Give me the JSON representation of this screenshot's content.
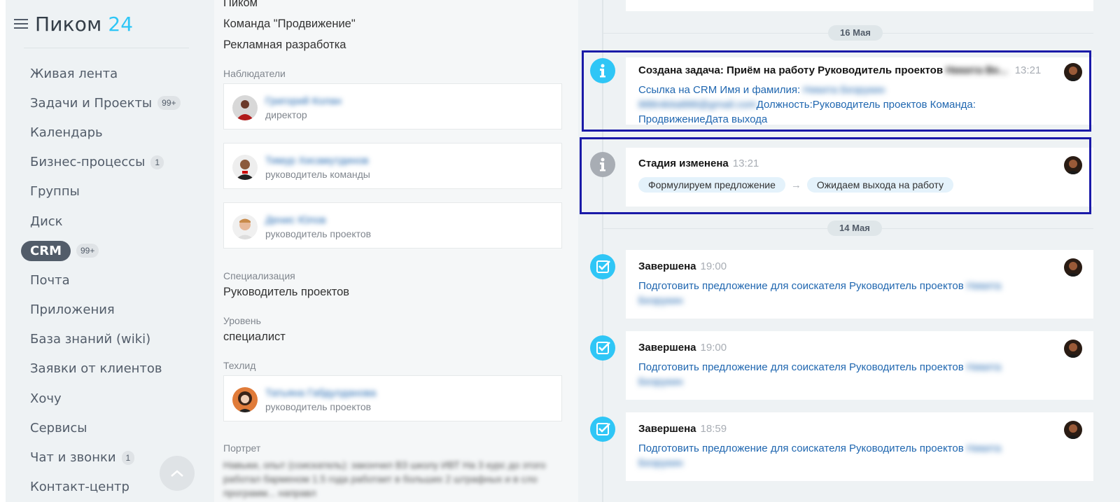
{
  "app": {
    "name": "Пиком",
    "number": "24"
  },
  "sidebar": {
    "items": [
      {
        "label": "Живая лента"
      },
      {
        "label": "Задачи и Проекты",
        "counter": "99+"
      },
      {
        "label": "Календарь"
      },
      {
        "label": "Бизнес-процессы",
        "counter": "1"
      },
      {
        "label": "Группы"
      },
      {
        "label": "Диск"
      },
      {
        "label": "CRM",
        "counter": "99+",
        "active": true
      },
      {
        "label": "Почта"
      },
      {
        "label": "Приложения"
      },
      {
        "label": "База знаний (wiki)"
      },
      {
        "label": "Заявки от клиентов"
      },
      {
        "label": "Хочу"
      },
      {
        "label": "Сервисы"
      },
      {
        "label": "Чат и звонки",
        "counter": "1"
      },
      {
        "label": "Контакт-центр"
      }
    ]
  },
  "details": {
    "company": "Пиком",
    "team": "Команда \"Продвижение\"",
    "department": "Рекламная разработка",
    "observers_label": "Наблюдатели",
    "observers": [
      {
        "name": "Григорий Колан",
        "role": "директор"
      },
      {
        "name": "Тимур Хисамутдинов",
        "role": "руководитель команды"
      },
      {
        "name": "Денис Юлов",
        "role": "руководитель проектов"
      }
    ],
    "specialization_label": "Специализация",
    "specialization": "Руководитель проектов",
    "level_label": "Уровень",
    "level": "специалист",
    "techlead_label": "Техлид",
    "techlead": {
      "name": "Татьяна Габдулданова",
      "role": "руководитель проектов"
    },
    "portrait_label": "Портрет",
    "portrait_text": "Навыки, опыт (соискатель): закончил ВЗ школу ИВТ На 3 курс до этого работал барменом 1.5 года работает в больших 2 штрафных и в сло программ... направл"
  },
  "timeline": {
    "dates": [
      "16 Мая",
      "14 Мая"
    ],
    "events": [
      {
        "title": "Создана задача: Приём на работу Руководитель проектов",
        "title_blur": "Никита Ве...",
        "time": "13:21",
        "link_part1": "Ссылка на CRM Имя и фамилия:",
        "link_blur1": "Никита Безрукин",
        "link_blur2": "888nikita888@gmail.com",
        "link_part2": "Должность:Руководитель проектов Команда:",
        "link_part3": "ПродвижениеДата выхода"
      },
      {
        "title": "Стадия изменена",
        "time": "13:21",
        "stage_from": "Формулируем предложение",
        "arrow": "→",
        "stage_to": "Ожидаем выхода на работу"
      },
      {
        "title": "Завершена",
        "time": "19:00",
        "link": "Подготовить предложение для соискателя Руководитель проектов",
        "link_blur1": "Никита",
        "link_blur2": "Безрукин"
      },
      {
        "title": "Завершена",
        "time": "19:00",
        "link": "Подготовить предложение для соискателя Руководитель проектов",
        "link_blur1": "Никита",
        "link_blur2": "Безрукин"
      },
      {
        "title": "Завершена",
        "time": "18:59",
        "link": "Подготовить предложение для соискателя Руководитель проектов",
        "link_blur1": "Никита",
        "link_blur2": "Безрукин"
      }
    ]
  },
  "colors": {
    "accent": "#2fc6f6",
    "link": "#2067b0",
    "highlight": "#1a1aa8",
    "sidebar_bg": "#eef2f4"
  }
}
